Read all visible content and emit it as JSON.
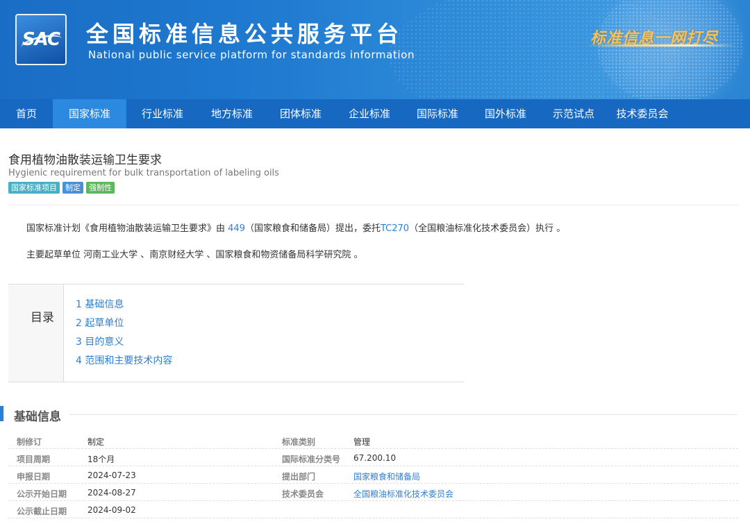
{
  "header": {
    "logo_text": "SAC",
    "title": "全国标准信息公共服务平台",
    "subtitle": "National public service platform  for standards information",
    "slogan": "标准信息一网打尽"
  },
  "nav": {
    "items": [
      {
        "label": "首页"
      },
      {
        "label": "国家标准",
        "active": true
      },
      {
        "label": "行业标准"
      },
      {
        "label": "地方标准"
      },
      {
        "label": "团体标准"
      },
      {
        "label": "企业标准"
      },
      {
        "label": "国际标准"
      },
      {
        "label": "国外标准"
      },
      {
        "label": "示范试点"
      },
      {
        "label": "技术委员会"
      }
    ]
  },
  "standard": {
    "title": "食用植物油散装运输卫生要求",
    "title_en": "Hygienic requirement for bulk transportation of labeling oils",
    "tags": [
      "国家标准项目",
      "制定",
      "强制性"
    ],
    "plan_prefix": "国家标准计划《食用植物油散装运输卫生要求》由 ",
    "plan_code": "449",
    "plan_mid": "（国家粮食和储备局）提出，委托",
    "plan_tc": "TC270",
    "plan_suffix": "（全国粮油标准化技术委员会）执行 。",
    "drafters": "主要起草单位 河南工业大学 、南京财经大学 、国家粮食和物资储备局科学研究院 。"
  },
  "toc": {
    "label": "目录",
    "items": [
      "1  基础信息",
      "2  起草单位",
      "3  目的意义",
      "4  范围和主要技术内容"
    ]
  },
  "basic_info": {
    "title": "基础信息",
    "left": [
      {
        "label": "制修订",
        "value": "制定"
      },
      {
        "label": "项目周期",
        "value": "18个月"
      },
      {
        "label": "申报日期",
        "value": "2024-07-23"
      },
      {
        "label": "公示开始日期",
        "value": "2024-08-27"
      },
      {
        "label": "公示截止日期",
        "value": "2024-09-02"
      }
    ],
    "right": [
      {
        "label": "标准类别",
        "value": "管理"
      },
      {
        "label": "国际标准分类号",
        "value": "67.200.10"
      },
      {
        "label": "提出部门",
        "value": "国家粮食和储备局"
      },
      {
        "label": "技术委员会",
        "value": "全国粮油标准化技术委员会"
      }
    ]
  },
  "colors": {
    "header_blue": "#1a6dc4",
    "nav_blue": "#1668c1",
    "nav_active": "#2b8ae0",
    "link": "#2f7fd1",
    "tag_project": "#48b0c6",
    "tag_type": "#4b8fd6",
    "tag_mandatory": "#5cb85c"
  }
}
